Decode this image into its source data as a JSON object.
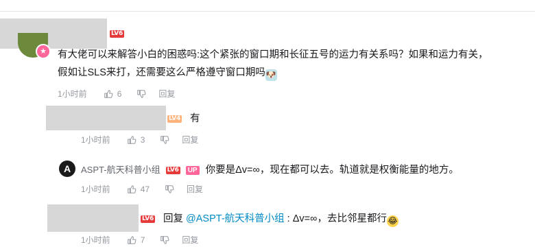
{
  "comment_main": {
    "level": "LV6",
    "avatar_badge": "★",
    "text_line1": "有大佬可以来解答小白的困惑吗:这个紧张的窗口期和长征五号的运力有关系吗？如果和运力有关，",
    "text_line2": "假如让SLS来打，还需要这么严格遵守窗口期吗",
    "time": "1小时前",
    "likes": "6",
    "reply_label": "回复"
  },
  "reply_1": {
    "level": "LV4",
    "text": "有",
    "time": "1小时前",
    "likes": "3",
    "reply_label": "回复"
  },
  "reply_2": {
    "avatar_letter": "A",
    "username": "ASPT-航天科普小组",
    "level": "LV6",
    "up_badge": "UP",
    "text": "你要是Δv=∞，现在都可以去。轨道就是权衡能量的地方。",
    "time": "1小时前",
    "likes": "47",
    "reply_label": "回复"
  },
  "reply_3": {
    "level": "LV6",
    "prefix": "回复 ",
    "mention": "@ASPT-航天科普小组",
    "text": " : Δv=∞，去比邻星都行",
    "time": "1小时前",
    "likes": "7",
    "reply_label": "回复"
  },
  "icons": {
    "like": "thumbs-up-icon",
    "dislike": "thumbs-down-icon",
    "emoji_1": "doge-emoji-icon",
    "emoji_2": "laugh-cry-emoji-icon"
  }
}
